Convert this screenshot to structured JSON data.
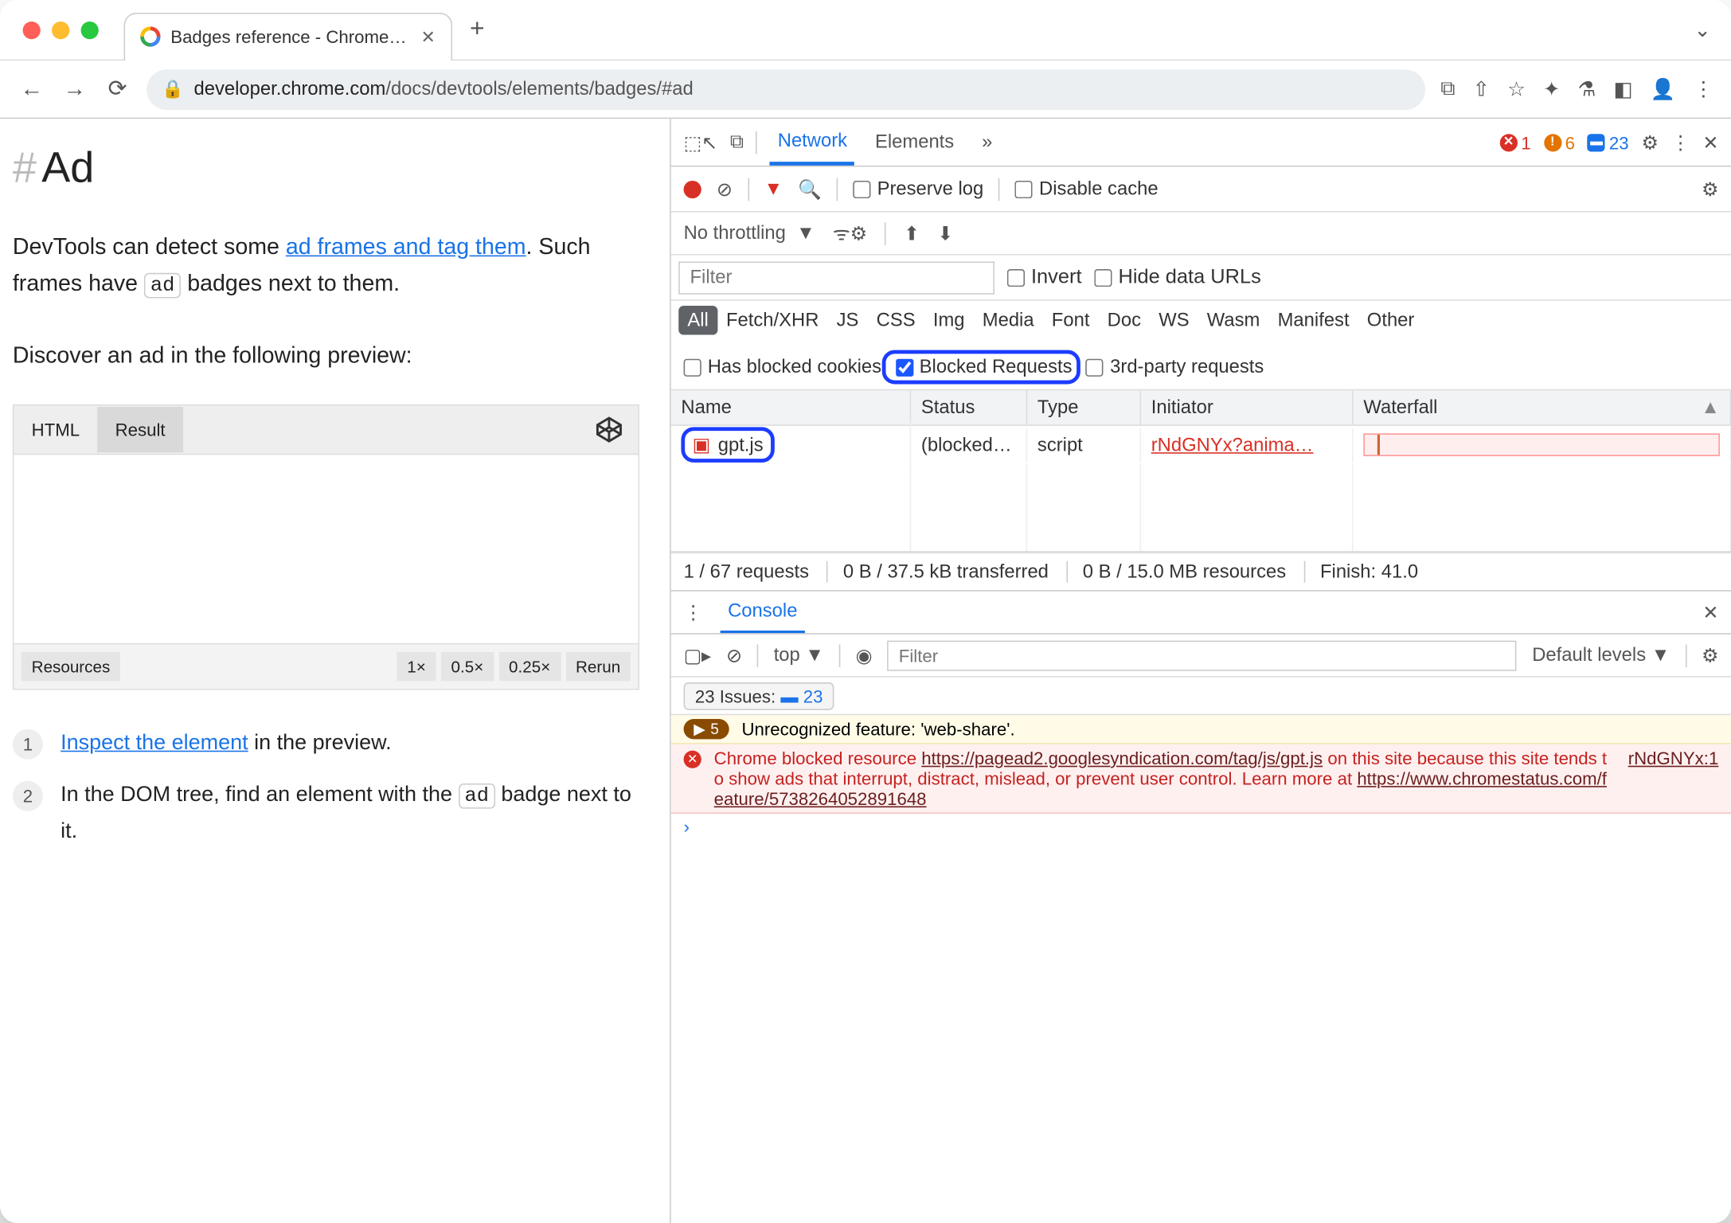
{
  "tab": {
    "title": "Badges reference - Chrome De"
  },
  "url": {
    "host": "developer.chrome.com",
    "path": "/docs/devtools/elements/badges/#ad"
  },
  "page": {
    "heading": "Ad",
    "p1a": "DevTools can detect some ",
    "p1link": "ad frames and tag them",
    "p1b": ". Such frames have ",
    "p1badge": "ad",
    "p1c": " badges next to them.",
    "p2": "Discover an ad in the following preview:",
    "embed": {
      "tab_html": "HTML",
      "tab_result": "Result",
      "bar": {
        "resources": "Resources",
        "x1": "1×",
        "x05": "0.5×",
        "x025": "0.25×",
        "rerun": "Rerun"
      }
    },
    "step1a": "Inspect the element",
    "step1b": " in the preview.",
    "step2a": "In the DOM tree, find an element with the ",
    "step2badge": "ad",
    "step2b": " badge next to it."
  },
  "devtools": {
    "tabs": {
      "network": "Network",
      "elements": "Elements"
    },
    "badges": {
      "errors": "1",
      "warnings": "6",
      "issues": "23"
    },
    "preserve": "Preserve log",
    "disable_cache": "Disable cache",
    "throttling": "No throttling",
    "filter_placeholder": "Filter",
    "invert": "Invert",
    "hide_urls": "Hide data URLs",
    "types": [
      "All",
      "Fetch/XHR",
      "JS",
      "CSS",
      "Img",
      "Media",
      "Font",
      "Doc",
      "WS",
      "Wasm",
      "Manifest",
      "Other"
    ],
    "has_blocked": "Has blocked cookies",
    "blocked_req": "Blocked Requests",
    "third_party": "3rd-party requests",
    "columns": {
      "name": "Name",
      "status": "Status",
      "type": "Type",
      "initiator": "Initiator",
      "waterfall": "Waterfall"
    },
    "row": {
      "name": "gpt.js",
      "status": "(blocked…",
      "type": "script",
      "initiator": "rNdGNYx?anima…"
    },
    "status_line": {
      "seg1": "1 / 67 requests",
      "seg2": "0 B / 37.5 kB transferred",
      "seg3": "0 B / 15.0 MB resources",
      "seg4": "Finish: 41.0"
    },
    "console": "Console",
    "ctx": "top",
    "levels": "Default levels",
    "issues_label": "23 Issues:",
    "issues_count": "23",
    "warn_count": "5",
    "warn_msg": "Unrecognized feature: 'web-share'.",
    "err": {
      "a": "Chrome blocked resource ",
      "url1": "https://pagead2.googlesyndication.com/tag/js/gpt.js",
      "b": " on this site because this site tends to show ads that interrupt, distract, mislead, or prevent user control. Learn more at ",
      "url2": "https://www.chromestatus.com/feature/5738264052891648",
      "src": "rNdGNYx:1"
    }
  }
}
